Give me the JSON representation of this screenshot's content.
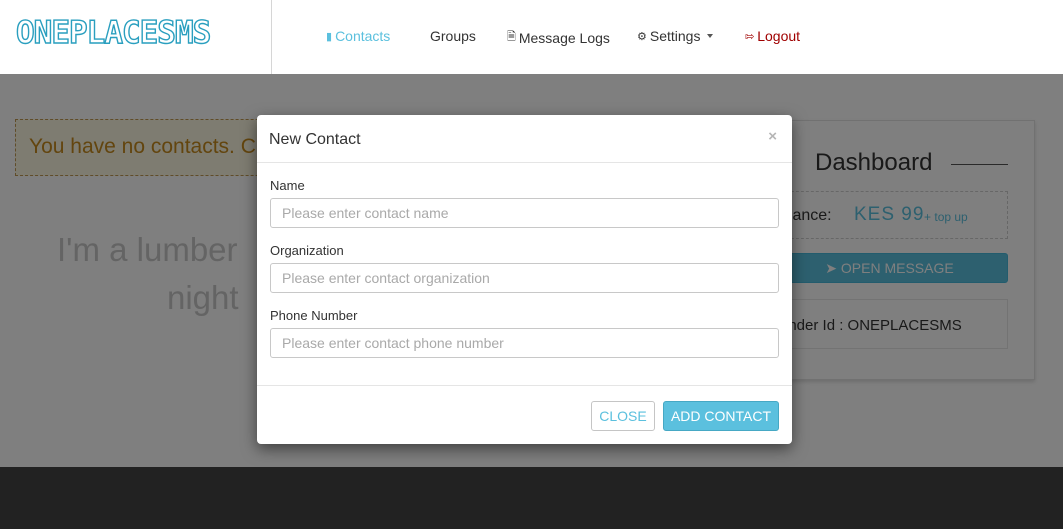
{
  "brand": {
    "name": "ONEPLACESMS"
  },
  "nav": {
    "items": [
      {
        "label": "Contacts",
        "icon": "book-icon"
      },
      {
        "label": "Groups"
      },
      {
        "label": "Message Logs",
        "icon": "file-icon"
      },
      {
        "label": "Settings",
        "icon": "gears-icon"
      },
      {
        "label": "Logout",
        "icon": "sign-out-icon"
      }
    ]
  },
  "alert": {
    "text": "You have no contacts. C"
  },
  "quote": {
    "line1": "I'm a lumber",
    "line2": "night"
  },
  "dashboard": {
    "title": "Dashboard",
    "balance_label": "alance:",
    "balance_value": "KES 99",
    "topup_label": "top up",
    "open_message_label": "OPEN MESSAGE",
    "sender_text": "ender Id : ONEPLACESMS"
  },
  "modal": {
    "title": "New Contact",
    "close_symbol": "×",
    "fields": [
      {
        "label": "Name",
        "placeholder": "Please enter contact name",
        "value": ""
      },
      {
        "label": "Organization",
        "placeholder": "Please enter contact organization",
        "value": ""
      },
      {
        "label": "Phone Number",
        "placeholder": "Please enter contact phone number",
        "value": ""
      }
    ],
    "close_button": "CLOSE",
    "add_button": "ADD CONTACT"
  },
  "colors": {
    "accent": "#5bc0de",
    "brand": "#2a9fbf",
    "logout": "#a00000",
    "alert_text": "#c68a1d"
  }
}
